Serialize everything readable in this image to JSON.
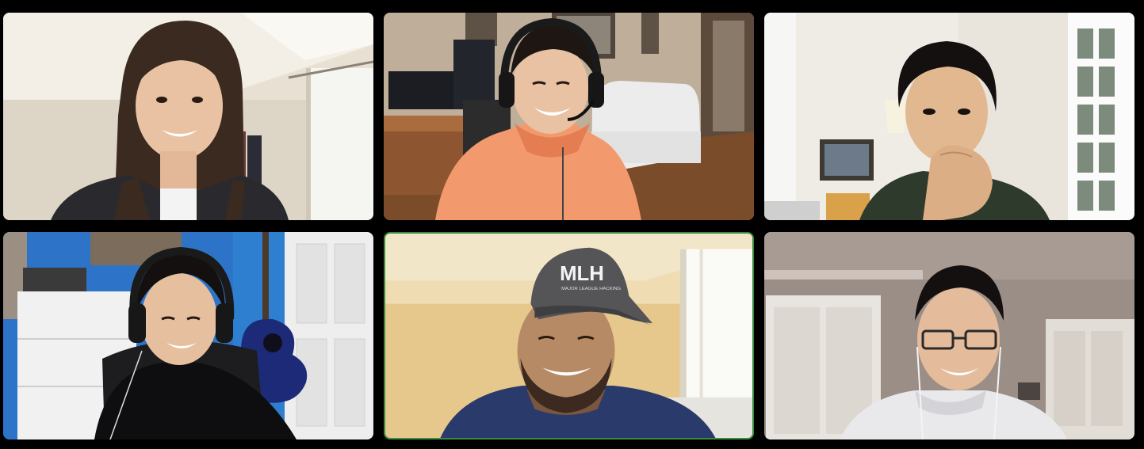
{
  "app": {
    "view": "gallery",
    "active_speaker_color": "#3c8a3c"
  },
  "participants": [
    {
      "id": 1,
      "active": false
    },
    {
      "id": 2,
      "active": false
    },
    {
      "id": 3,
      "active": false
    },
    {
      "id": 4,
      "active": false
    },
    {
      "id": 5,
      "active": true,
      "cap_logo": "MLH",
      "cap_tagline": "MAJOR LEAGUE HACKING"
    },
    {
      "id": 6,
      "active": false
    }
  ]
}
